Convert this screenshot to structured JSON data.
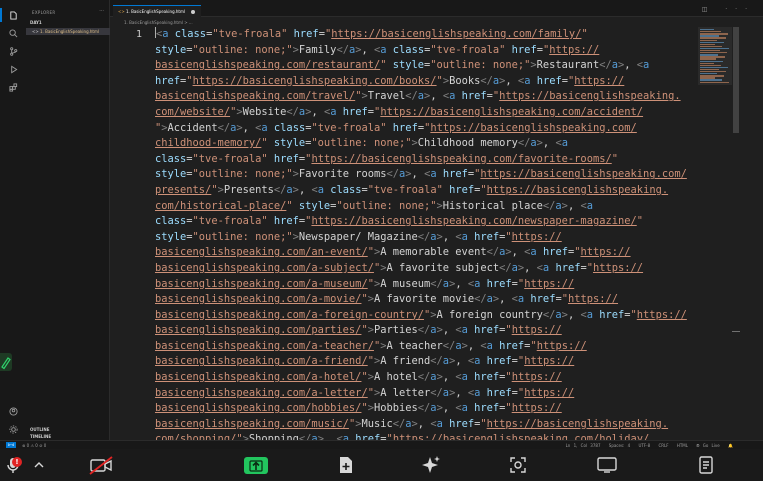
{
  "sidebar": {
    "title": "EXPLORER",
    "more": "···",
    "folder": "DAY1",
    "file": "1. BasicEnglishSpeaking.html",
    "outline": "OUTLINE",
    "timeline": "TIMELINE"
  },
  "tab": {
    "label": "1. BasicEnglishSpeaking.html",
    "actions": "◫ ···"
  },
  "breadcrumb": "1. BasicEnglishSpeaking.html > ...",
  "editor": {
    "line_number": "1"
  },
  "code_lines": [
    [
      [
        "p",
        "<"
      ],
      [
        "t",
        "a "
      ],
      [
        "a",
        "class"
      ],
      [
        "w",
        "="
      ],
      [
        "v",
        "\"tve-froala\" "
      ],
      [
        "a",
        "href"
      ],
      [
        "w",
        "="
      ],
      [
        "v",
        "\""
      ],
      [
        "u",
        "https://basicenglishspeaking.com/family/"
      ],
      [
        "v",
        "\""
      ]
    ],
    [
      [
        "a",
        "style"
      ],
      [
        "w",
        "="
      ],
      [
        "v",
        "\"outline: none;\""
      ],
      [
        "p",
        ">"
      ],
      [
        "w",
        "Family"
      ],
      [
        "p",
        "</"
      ],
      [
        "t",
        "a"
      ],
      [
        "p",
        ">"
      ],
      [
        "w",
        ", "
      ],
      [
        "p",
        "<"
      ],
      [
        "t",
        "a "
      ],
      [
        "a",
        "class"
      ],
      [
        "w",
        "="
      ],
      [
        "v",
        "\"tve-froala\" "
      ],
      [
        "a",
        "href"
      ],
      [
        "w",
        "="
      ],
      [
        "v",
        "\""
      ],
      [
        "u",
        "https://"
      ]
    ],
    [
      [
        "u",
        "basicenglishspeaking.com/restaurant/"
      ],
      [
        "v",
        "\" "
      ],
      [
        "a",
        "style"
      ],
      [
        "w",
        "="
      ],
      [
        "v",
        "\"outline: none;\""
      ],
      [
        "p",
        ">"
      ],
      [
        "w",
        "Restaurant"
      ],
      [
        "p",
        "</"
      ],
      [
        "t",
        "a"
      ],
      [
        "p",
        ">"
      ],
      [
        "w",
        ", "
      ],
      [
        "p",
        "<"
      ],
      [
        "t",
        "a"
      ]
    ],
    [
      [
        "a",
        "href"
      ],
      [
        "w",
        "="
      ],
      [
        "v",
        "\""
      ],
      [
        "u",
        "https://basicenglishspeaking.com/books/"
      ],
      [
        "v",
        "\""
      ],
      [
        "p",
        ">"
      ],
      [
        "w",
        "Books"
      ],
      [
        "p",
        "</"
      ],
      [
        "t",
        "a"
      ],
      [
        "p",
        ">"
      ],
      [
        "w",
        ", "
      ],
      [
        "p",
        "<"
      ],
      [
        "t",
        "a "
      ],
      [
        "a",
        "href"
      ],
      [
        "w",
        "="
      ],
      [
        "v",
        "\""
      ],
      [
        "u",
        "https://"
      ]
    ],
    [
      [
        "u",
        "basicenglishspeaking.com/travel/"
      ],
      [
        "v",
        "\""
      ],
      [
        "p",
        ">"
      ],
      [
        "w",
        "Travel"
      ],
      [
        "p",
        "</"
      ],
      [
        "t",
        "a"
      ],
      [
        "p",
        ">"
      ],
      [
        "w",
        ", "
      ],
      [
        "p",
        "<"
      ],
      [
        "t",
        "a "
      ],
      [
        "a",
        "href"
      ],
      [
        "w",
        "="
      ],
      [
        "v",
        "\""
      ],
      [
        "u",
        "https://basicenglishspeaking."
      ]
    ],
    [
      [
        "u",
        "com/website/"
      ],
      [
        "v",
        "\""
      ],
      [
        "p",
        ">"
      ],
      [
        "w",
        "Website"
      ],
      [
        "p",
        "</"
      ],
      [
        "t",
        "a"
      ],
      [
        "p",
        ">"
      ],
      [
        "w",
        ", "
      ],
      [
        "p",
        "<"
      ],
      [
        "t",
        "a "
      ],
      [
        "a",
        "href"
      ],
      [
        "w",
        "="
      ],
      [
        "v",
        "\""
      ],
      [
        "u",
        "https://basicenglishspeaking.com/accident/"
      ]
    ],
    [
      [
        "v",
        "\""
      ],
      [
        "p",
        ">"
      ],
      [
        "w",
        "Accident"
      ],
      [
        "p",
        "</"
      ],
      [
        "t",
        "a"
      ],
      [
        "p",
        ">"
      ],
      [
        "w",
        ", "
      ],
      [
        "p",
        "<"
      ],
      [
        "t",
        "a "
      ],
      [
        "a",
        "class"
      ],
      [
        "w",
        "="
      ],
      [
        "v",
        "\"tve-froala\" "
      ],
      [
        "a",
        "href"
      ],
      [
        "w",
        "="
      ],
      [
        "v",
        "\""
      ],
      [
        "u",
        "https://basicenglishspeaking.com/"
      ]
    ],
    [
      [
        "u",
        "childhood-memory/"
      ],
      [
        "v",
        "\" "
      ],
      [
        "a",
        "style"
      ],
      [
        "w",
        "="
      ],
      [
        "v",
        "\"outline: none;\""
      ],
      [
        "p",
        ">"
      ],
      [
        "w",
        "Childhood memory"
      ],
      [
        "p",
        "</"
      ],
      [
        "t",
        "a"
      ],
      [
        "p",
        ">"
      ],
      [
        "w",
        ", "
      ],
      [
        "p",
        "<"
      ],
      [
        "t",
        "a"
      ]
    ],
    [
      [
        "a",
        "class"
      ],
      [
        "w",
        "="
      ],
      [
        "v",
        "\"tve-froala\" "
      ],
      [
        "a",
        "href"
      ],
      [
        "w",
        "="
      ],
      [
        "v",
        "\""
      ],
      [
        "u",
        "https://basicenglishspeaking.com/favorite-rooms/"
      ],
      [
        "v",
        "\""
      ]
    ],
    [
      [
        "a",
        "style"
      ],
      [
        "w",
        "="
      ],
      [
        "v",
        "\"outline: none;\""
      ],
      [
        "p",
        ">"
      ],
      [
        "w",
        "Favorite rooms"
      ],
      [
        "p",
        "</"
      ],
      [
        "t",
        "a"
      ],
      [
        "p",
        ">"
      ],
      [
        "w",
        ", "
      ],
      [
        "p",
        "<"
      ],
      [
        "t",
        "a "
      ],
      [
        "a",
        "href"
      ],
      [
        "w",
        "="
      ],
      [
        "v",
        "\""
      ],
      [
        "u",
        "https://basicenglishspeaking.com/"
      ]
    ],
    [
      [
        "u",
        "presents/"
      ],
      [
        "v",
        "\""
      ],
      [
        "p",
        ">"
      ],
      [
        "w",
        "Presents"
      ],
      [
        "p",
        "</"
      ],
      [
        "t",
        "a"
      ],
      [
        "p",
        ">"
      ],
      [
        "w",
        ", "
      ],
      [
        "p",
        "<"
      ],
      [
        "t",
        "a "
      ],
      [
        "a",
        "class"
      ],
      [
        "w",
        "="
      ],
      [
        "v",
        "\"tve-froala\" "
      ],
      [
        "a",
        "href"
      ],
      [
        "w",
        "="
      ],
      [
        "v",
        "\""
      ],
      [
        "u",
        "https://basicenglishspeaking."
      ]
    ],
    [
      [
        "u",
        "com/historical-place/"
      ],
      [
        "v",
        "\" "
      ],
      [
        "a",
        "style"
      ],
      [
        "w",
        "="
      ],
      [
        "v",
        "\"outline: none;\""
      ],
      [
        "p",
        ">"
      ],
      [
        "w",
        "Historical place"
      ],
      [
        "p",
        "</"
      ],
      [
        "t",
        "a"
      ],
      [
        "p",
        ">"
      ],
      [
        "w",
        ", "
      ],
      [
        "p",
        "<"
      ],
      [
        "t",
        "a"
      ]
    ],
    [
      [
        "a",
        "class"
      ],
      [
        "w",
        "="
      ],
      [
        "v",
        "\"tve-froala\" "
      ],
      [
        "a",
        "href"
      ],
      [
        "w",
        "="
      ],
      [
        "v",
        "\""
      ],
      [
        "u",
        "https://basicenglishspeaking.com/newspaper-magazine/"
      ],
      [
        "v",
        "\""
      ]
    ],
    [
      [
        "a",
        "style"
      ],
      [
        "w",
        "="
      ],
      [
        "v",
        "\"outline: none;\""
      ],
      [
        "p",
        ">"
      ],
      [
        "w",
        "Newspaper/ Magazine"
      ],
      [
        "p",
        "</"
      ],
      [
        "t",
        "a"
      ],
      [
        "p",
        ">"
      ],
      [
        "w",
        ", "
      ],
      [
        "p",
        "<"
      ],
      [
        "t",
        "a "
      ],
      [
        "a",
        "href"
      ],
      [
        "w",
        "="
      ],
      [
        "v",
        "\""
      ],
      [
        "u",
        "https://"
      ]
    ],
    [
      [
        "u",
        "basicenglishspeaking.com/an-event/"
      ],
      [
        "v",
        "\""
      ],
      [
        "p",
        ">"
      ],
      [
        "w",
        "A memorable event"
      ],
      [
        "p",
        "</"
      ],
      [
        "t",
        "a"
      ],
      [
        "p",
        ">"
      ],
      [
        "w",
        ", "
      ],
      [
        "p",
        "<"
      ],
      [
        "t",
        "a "
      ],
      [
        "a",
        "href"
      ],
      [
        "w",
        "="
      ],
      [
        "v",
        "\""
      ],
      [
        "u",
        "https://"
      ]
    ],
    [
      [
        "u",
        "basicenglishspeaking.com/a-subject/"
      ],
      [
        "v",
        "\""
      ],
      [
        "p",
        ">"
      ],
      [
        "w",
        "A favorite subject"
      ],
      [
        "p",
        "</"
      ],
      [
        "t",
        "a"
      ],
      [
        "p",
        ">"
      ],
      [
        "w",
        ", "
      ],
      [
        "p",
        "<"
      ],
      [
        "t",
        "a "
      ],
      [
        "a",
        "href"
      ],
      [
        "w",
        "="
      ],
      [
        "v",
        "\""
      ],
      [
        "u",
        "https://"
      ]
    ],
    [
      [
        "u",
        "basicenglishspeaking.com/a-museum/"
      ],
      [
        "v",
        "\""
      ],
      [
        "p",
        ">"
      ],
      [
        "w",
        "A museum"
      ],
      [
        "p",
        "</"
      ],
      [
        "t",
        "a"
      ],
      [
        "p",
        ">"
      ],
      [
        "w",
        ", "
      ],
      [
        "p",
        "<"
      ],
      [
        "t",
        "a "
      ],
      [
        "a",
        "href"
      ],
      [
        "w",
        "="
      ],
      [
        "v",
        "\""
      ],
      [
        "u",
        "https://"
      ]
    ],
    [
      [
        "u",
        "basicenglishspeaking.com/a-movie/"
      ],
      [
        "v",
        "\""
      ],
      [
        "p",
        ">"
      ],
      [
        "w",
        "A favorite movie"
      ],
      [
        "p",
        "</"
      ],
      [
        "t",
        "a"
      ],
      [
        "p",
        ">"
      ],
      [
        "w",
        ", "
      ],
      [
        "p",
        "<"
      ],
      [
        "t",
        "a "
      ],
      [
        "a",
        "href"
      ],
      [
        "w",
        "="
      ],
      [
        "v",
        "\""
      ],
      [
        "u",
        "https://"
      ]
    ],
    [
      [
        "u",
        "basicenglishspeaking.com/a-foreign-country/"
      ],
      [
        "v",
        "\""
      ],
      [
        "p",
        ">"
      ],
      [
        "w",
        "A foreign country"
      ],
      [
        "p",
        "</"
      ],
      [
        "t",
        "a"
      ],
      [
        "p",
        ">"
      ],
      [
        "w",
        ", "
      ],
      [
        "p",
        "<"
      ],
      [
        "t",
        "a "
      ],
      [
        "a",
        "href"
      ],
      [
        "w",
        "="
      ],
      [
        "v",
        "\""
      ],
      [
        "u",
        "https://"
      ]
    ],
    [
      [
        "u",
        "basicenglishspeaking.com/parties/"
      ],
      [
        "v",
        "\""
      ],
      [
        "p",
        ">"
      ],
      [
        "w",
        "Parties"
      ],
      [
        "p",
        "</"
      ],
      [
        "t",
        "a"
      ],
      [
        "p",
        ">"
      ],
      [
        "w",
        ", "
      ],
      [
        "p",
        "<"
      ],
      [
        "t",
        "a "
      ],
      [
        "a",
        "href"
      ],
      [
        "w",
        "="
      ],
      [
        "v",
        "\""
      ],
      [
        "u",
        "https://"
      ]
    ],
    [
      [
        "u",
        "basicenglishspeaking.com/a-teacher/"
      ],
      [
        "v",
        "\""
      ],
      [
        "p",
        ">"
      ],
      [
        "w",
        "A teacher"
      ],
      [
        "p",
        "</"
      ],
      [
        "t",
        "a"
      ],
      [
        "p",
        ">"
      ],
      [
        "w",
        ", "
      ],
      [
        "p",
        "<"
      ],
      [
        "t",
        "a "
      ],
      [
        "a",
        "href"
      ],
      [
        "w",
        "="
      ],
      [
        "v",
        "\""
      ],
      [
        "u",
        "https://"
      ]
    ],
    [
      [
        "u",
        "basicenglishspeaking.com/a-friend/"
      ],
      [
        "v",
        "\""
      ],
      [
        "p",
        ">"
      ],
      [
        "w",
        "A friend"
      ],
      [
        "p",
        "</"
      ],
      [
        "t",
        "a"
      ],
      [
        "p",
        ">"
      ],
      [
        "w",
        ", "
      ],
      [
        "p",
        "<"
      ],
      [
        "t",
        "a "
      ],
      [
        "a",
        "href"
      ],
      [
        "w",
        "="
      ],
      [
        "v",
        "\""
      ],
      [
        "u",
        "https://"
      ]
    ],
    [
      [
        "u",
        "basicenglishspeaking.com/a-hotel/"
      ],
      [
        "v",
        "\""
      ],
      [
        "p",
        ">"
      ],
      [
        "w",
        "A hotel"
      ],
      [
        "p",
        "</"
      ],
      [
        "t",
        "a"
      ],
      [
        "p",
        ">"
      ],
      [
        "w",
        ", "
      ],
      [
        "p",
        "<"
      ],
      [
        "t",
        "a "
      ],
      [
        "a",
        "href"
      ],
      [
        "w",
        "="
      ],
      [
        "v",
        "\""
      ],
      [
        "u",
        "https://"
      ]
    ],
    [
      [
        "u",
        "basicenglishspeaking.com/a-letter/"
      ],
      [
        "v",
        "\""
      ],
      [
        "p",
        ">"
      ],
      [
        "w",
        "A letter"
      ],
      [
        "p",
        "</"
      ],
      [
        "t",
        "a"
      ],
      [
        "p",
        ">"
      ],
      [
        "w",
        ", "
      ],
      [
        "p",
        "<"
      ],
      [
        "t",
        "a "
      ],
      [
        "a",
        "href"
      ],
      [
        "w",
        "="
      ],
      [
        "v",
        "\""
      ],
      [
        "u",
        "https://"
      ]
    ],
    [
      [
        "u",
        "basicenglishspeaking.com/hobbies/"
      ],
      [
        "v",
        "\""
      ],
      [
        "p",
        ">"
      ],
      [
        "w",
        "Hobbies"
      ],
      [
        "p",
        "</"
      ],
      [
        "t",
        "a"
      ],
      [
        "p",
        ">"
      ],
      [
        "w",
        ", "
      ],
      [
        "p",
        "<"
      ],
      [
        "t",
        "a "
      ],
      [
        "a",
        "href"
      ],
      [
        "w",
        "="
      ],
      [
        "v",
        "\""
      ],
      [
        "u",
        "https://"
      ]
    ],
    [
      [
        "u",
        "basicenglishspeaking.com/music/"
      ],
      [
        "v",
        "\""
      ],
      [
        "p",
        ">"
      ],
      [
        "w",
        "Music"
      ],
      [
        "p",
        "</"
      ],
      [
        "t",
        "a"
      ],
      [
        "p",
        ">"
      ],
      [
        "w",
        ", "
      ],
      [
        "p",
        "<"
      ],
      [
        "t",
        "a "
      ],
      [
        "a",
        "href"
      ],
      [
        "w",
        "="
      ],
      [
        "v",
        "\""
      ],
      [
        "u",
        "https://basicenglishspeaking."
      ]
    ],
    [
      [
        "u",
        "com/shopping/"
      ],
      [
        "v",
        "\""
      ],
      [
        "p",
        ">"
      ],
      [
        "w",
        "Shopping"
      ],
      [
        "p",
        "</"
      ],
      [
        "t",
        "a"
      ],
      [
        "p",
        ">"
      ],
      [
        "w",
        ", "
      ],
      [
        "p",
        "<"
      ],
      [
        "t",
        "a "
      ],
      [
        "a",
        "href"
      ],
      [
        "w",
        "="
      ],
      [
        "v",
        "\""
      ],
      [
        "u",
        "https://basicenglishspeaking.com/holiday/"
      ]
    ]
  ],
  "statusbar": {
    "remote": "⊳⊲",
    "problems": "⊗ 0  ⚠ 0   ⊘ 0",
    "position": "Ln 1, Col 3787",
    "spaces": "Spaces: 4",
    "encoding": "UTF-8",
    "eol": "CRLF",
    "language": "HTML",
    "go_live": "⦾ Go Live",
    "bell": "🔔"
  },
  "meeting": {
    "mic_badge": "!"
  },
  "colors": {
    "accent": "#0078d4",
    "share_green": "#22c55e",
    "alert_red": "#e02424"
  }
}
